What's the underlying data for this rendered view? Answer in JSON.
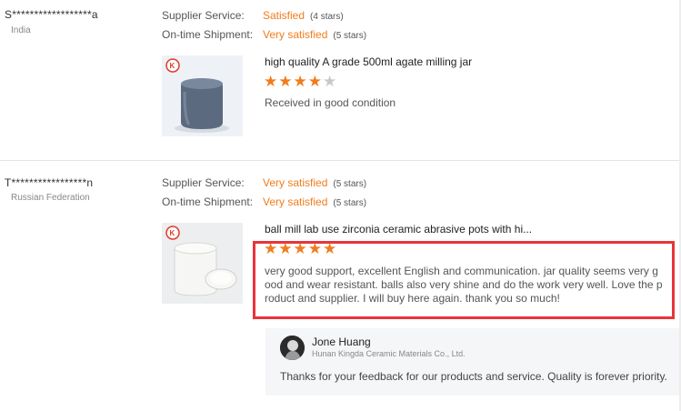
{
  "labels": {
    "supplier_service": "Supplier Service:",
    "ontime_shipment": "On-time Shipment:"
  },
  "reviews": [
    {
      "name": "S******************a",
      "country": "India",
      "supplier_service": {
        "value": "Satisfied",
        "stars_text": "(4 stars)"
      },
      "ontime_shipment": {
        "value": "Very satisfied",
        "stars_text": "(5 stars)"
      },
      "product_title": "high quality A grade 500ml agate milling jar",
      "rating": 4,
      "text_lines": [
        "Received in good condition"
      ]
    },
    {
      "name": "T*****************n",
      "country": "Russian Federation",
      "supplier_service": {
        "value": "Very satisfied",
        "stars_text": "(5 stars)"
      },
      "ontime_shipment": {
        "value": "Very satisfied",
        "stars_text": "(5 stars)"
      },
      "product_title": "ball mill lab use zirconia ceramic abrasive pots with hi...",
      "rating": 5,
      "text_lines": [
        "very good support, excellent English and communication. jar quality seems very g",
        "ood and wear resistant. balls also very shine and do the work very well. Love the p",
        "roduct and supplier. I will buy here again. thank you so much!"
      ],
      "reply": {
        "name": "Jone Huang",
        "company": "Hunan Kingda Ceramic Materials Co., Ltd.",
        "text": "Thanks for your feedback for our products and service. Quality is forever priority."
      }
    }
  ],
  "colors": {
    "accent": "#f07c1e",
    "highlight": "#e8343a",
    "star_off": "#c8c8c8"
  },
  "icons": {
    "star": "star-icon",
    "logo": "brand-logo-icon",
    "avatar": "avatar-icon"
  }
}
